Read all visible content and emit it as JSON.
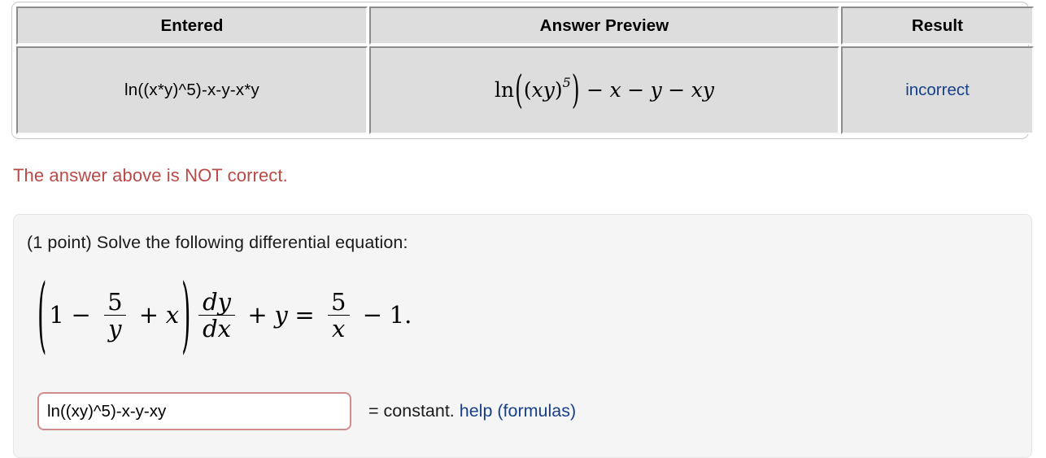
{
  "results_table": {
    "headers": [
      "Entered",
      "Answer Preview",
      "Result"
    ],
    "row": {
      "entered": "ln((x*y)^5)-x-y-x*y",
      "answer_preview_text": "ln((xy)^5) - x - y - xy",
      "answer_preview": {
        "ln": "ln",
        "x": "x",
        "y": "y",
        "exponent": "5",
        "minus": "−",
        "open_paren": "(",
        "close_paren": ")"
      },
      "result": "incorrect",
      "result_color": "#d7908f",
      "result_text_color": "#17408b"
    }
  },
  "feedback": {
    "message": "The answer above is NOT correct.",
    "color": "#b94a48"
  },
  "problem": {
    "statement": "(1 point) Solve the following differential equation:",
    "equation_text": "(1 - 5/y + x) dy/dx + y = 5/x - 1.",
    "equation": {
      "one": "1",
      "minus": "−",
      "plus": "+",
      "equals": "=",
      "five": "5",
      "x": "x",
      "y": "y",
      "dy": "dy",
      "dx": "dx",
      "period": ".",
      "open_paren": "(",
      "close_paren": ")"
    },
    "answer": {
      "value": "ln((xy)^5)-x-y-xy",
      "placeholder": "",
      "border_color": "#cf8d8b",
      "suffix": "= constant.",
      "help_link": "help (formulas)",
      "help_link_color": "#17408b"
    }
  }
}
